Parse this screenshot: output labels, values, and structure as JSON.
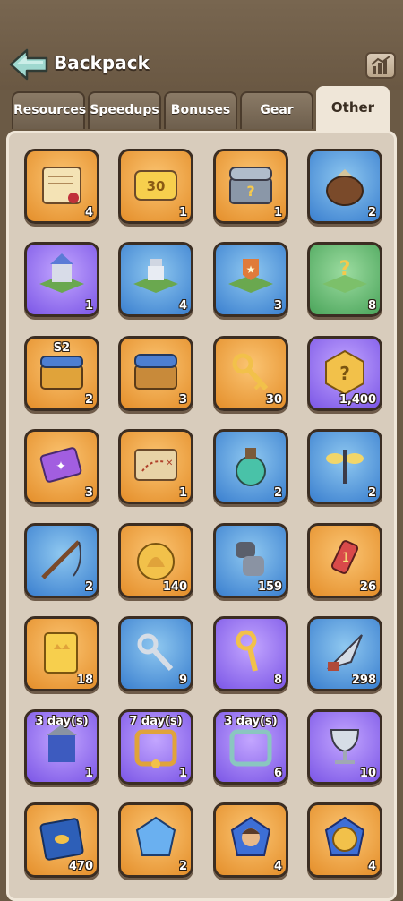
{
  "header": {
    "title": "Backpack"
  },
  "tabs": [
    {
      "label": "Resources"
    },
    {
      "label": "Speedups"
    },
    {
      "label": "Bonuses"
    },
    {
      "label": "Gear"
    },
    {
      "label": "Other"
    }
  ],
  "active_tab": "Other",
  "items": [
    {
      "name": "scroll-icon",
      "bg": "orange",
      "count": "4",
      "badge": ""
    },
    {
      "name": "ticket-30-icon",
      "bg": "orange",
      "count": "1",
      "badge": ""
    },
    {
      "name": "mystery-chest-icon",
      "bg": "orange",
      "count": "1",
      "badge": ""
    },
    {
      "name": "seed-bag-icon",
      "bg": "blue",
      "count": "2",
      "badge": ""
    },
    {
      "name": "castle-relocate-icon",
      "bg": "purple",
      "count": "1",
      "badge": ""
    },
    {
      "name": "advanced-relocate-icon",
      "bg": "blue",
      "count": "4",
      "badge": ""
    },
    {
      "name": "alliance-relocate-icon",
      "bg": "blue",
      "count": "3",
      "badge": ""
    },
    {
      "name": "random-relocate-icon",
      "bg": "green",
      "count": "8",
      "badge": ""
    },
    {
      "name": "s2-chest-icon",
      "bg": "orange",
      "count": "2",
      "badge": "S2"
    },
    {
      "name": "treasure-chest-icon",
      "bg": "orange",
      "count": "3",
      "badge": ""
    },
    {
      "name": "golden-key-icon",
      "bg": "orange",
      "count": "30",
      "badge": ""
    },
    {
      "name": "hex-token-icon",
      "bg": "purple",
      "count": "1,400",
      "badge": ""
    },
    {
      "name": "purple-ticket-icon",
      "bg": "orange",
      "count": "3",
      "badge": ""
    },
    {
      "name": "treasure-map-icon",
      "bg": "orange",
      "count": "1",
      "badge": ""
    },
    {
      "name": "potion-flask-icon",
      "bg": "blue",
      "count": "2",
      "badge": ""
    },
    {
      "name": "dragonfly-icon",
      "bg": "blue",
      "count": "2",
      "badge": ""
    },
    {
      "name": "fishing-rod-icon",
      "bg": "blue",
      "count": "2",
      "badge": ""
    },
    {
      "name": "shell-coin-icon",
      "bg": "orange",
      "count": "140",
      "badge": ""
    },
    {
      "name": "gauntlet-icon",
      "bg": "blue",
      "count": "159",
      "badge": ""
    },
    {
      "name": "firework-rocket-icon",
      "bg": "orange",
      "count": "26",
      "badge": ""
    },
    {
      "name": "gold-ticket-icon",
      "bg": "orange",
      "count": "18",
      "badge": ""
    },
    {
      "name": "silver-key-icon",
      "bg": "blue",
      "count": "9",
      "badge": ""
    },
    {
      "name": "gold-key-icon",
      "bg": "purple",
      "count": "8",
      "badge": ""
    },
    {
      "name": "arrowhead-icon",
      "bg": "blue",
      "count": "298",
      "badge": ""
    },
    {
      "name": "castle-skin-icon",
      "bg": "purple",
      "count": "1",
      "badge": "3 day(s)"
    },
    {
      "name": "frame-gold-icon",
      "bg": "purple",
      "count": "1",
      "badge": "7 day(s)"
    },
    {
      "name": "frame-vine-icon",
      "bg": "purple",
      "count": "6",
      "badge": "3 day(s)"
    },
    {
      "name": "silver-chalice-icon",
      "bg": "purple",
      "count": "10",
      "badge": ""
    },
    {
      "name": "blue-book-icon",
      "bg": "orange",
      "count": "470",
      "badge": ""
    },
    {
      "name": "blue-crystal-icon",
      "bg": "orange",
      "count": "2",
      "badge": ""
    },
    {
      "name": "hero-shard-icon",
      "bg": "orange",
      "count": "4",
      "badge": ""
    },
    {
      "name": "lion-emblem-icon",
      "bg": "orange",
      "count": "4",
      "badge": ""
    }
  ]
}
